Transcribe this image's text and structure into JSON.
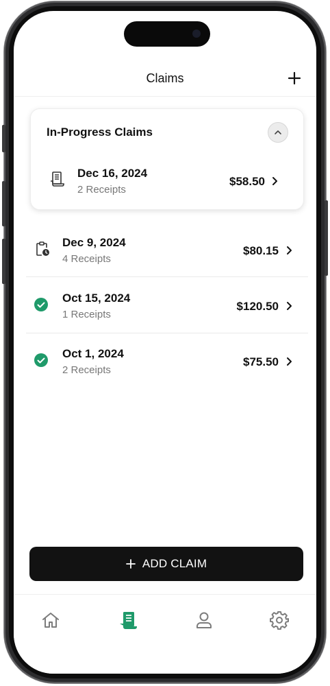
{
  "header": {
    "title": "Claims",
    "add_icon": "plus-icon"
  },
  "in_progress": {
    "title": "In-Progress Claims",
    "collapse_icon": "chevron-up-icon",
    "claim": {
      "date": "Dec 16, 2024",
      "receipts": "2 Receipts",
      "amount": "$58.50",
      "icon": "receipt-icon"
    }
  },
  "claims": [
    {
      "date": "Dec 9, 2024",
      "receipts": "4 Receipts",
      "amount": "$80.15",
      "status": "pending",
      "icon": "clipboard-clock-icon"
    },
    {
      "date": "Oct 15, 2024",
      "receipts": "1 Receipts",
      "amount": "$120.50",
      "status": "approved",
      "icon": "check-circle-icon"
    },
    {
      "date": "Oct 1, 2024",
      "receipts": "2 Receipts",
      "amount": "$75.50",
      "status": "approved",
      "icon": "check-circle-icon"
    }
  ],
  "add_claim": {
    "label": "ADD CLAIM",
    "icon": "plus-icon"
  },
  "tabs": [
    {
      "name": "home",
      "icon": "home-icon",
      "active": false
    },
    {
      "name": "claims",
      "icon": "receipt-icon",
      "active": true
    },
    {
      "name": "profile",
      "icon": "user-icon",
      "active": false
    },
    {
      "name": "settings",
      "icon": "gear-icon",
      "active": false
    }
  ],
  "colors": {
    "accent": "#1f9a6a",
    "text": "#111111",
    "muted": "#777777",
    "button": "#121212",
    "icon_inactive": "#7c7c7c"
  }
}
